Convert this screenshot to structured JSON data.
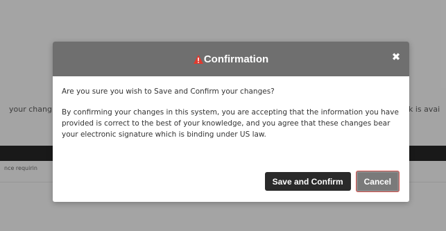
{
  "background": {
    "left_text": "your chang",
    "right_text": "k is avai",
    "note_text": "nce requirin"
  },
  "modal": {
    "title": "Confirmation",
    "title_icon": "warning-triangle-icon",
    "close_icon": "close-icon",
    "close_symbol": "✖",
    "question": "Are you sure you wish to Save and Confirm your changes?",
    "statement": "By confirming your changes in this system, you are accepting that the information you have provided is correct to the best of your knowledge, and you agree that these changes bear your electronic signature which is binding under US law.",
    "buttons": {
      "confirm_label": "Save and Confirm",
      "cancel_label": "Cancel"
    }
  },
  "colors": {
    "header": "#6f6f6f",
    "warning": "#e03a2f",
    "primary_button": "#2a2a2a",
    "cancel_button": "#7a7a7a",
    "cancel_border": "#d9534f"
  }
}
